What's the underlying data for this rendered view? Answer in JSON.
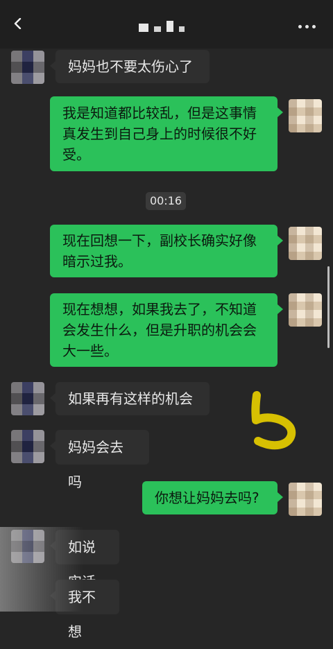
{
  "header": {
    "back_icon": "chevron-left-icon",
    "more_icon": "more-dots-icon"
  },
  "messages": [
    {
      "side": "left",
      "text": "妈妈也不要太伤心了"
    },
    {
      "side": "right",
      "lines": [
        "我是知道都比较乱，但是这事情",
        "真发生到自己身上的时候很不好",
        "受。"
      ]
    },
    {
      "type": "time",
      "text": "00:16"
    },
    {
      "side": "right",
      "lines": [
        "现在回想一下，副校长确实好像",
        "暗示过我。"
      ]
    },
    {
      "side": "right",
      "lines": [
        "现在想想，如果我去了，不知道",
        "会发生什么，但是升职的机会会",
        "大一些。"
      ]
    },
    {
      "side": "left",
      "text": "如果再有这样的机会"
    },
    {
      "side": "left",
      "text": "妈妈会去吗"
    },
    {
      "side": "right",
      "text": "你想让妈妈去吗?"
    },
    {
      "side": "left",
      "text": "如说实话"
    },
    {
      "side": "left",
      "text": "我不想"
    }
  ],
  "colors": {
    "background": "#262626",
    "topbar": "#1f1f1f",
    "bubble_left": "#2f2f2f",
    "bubble_right": "#2bc15a",
    "time_bg": "#3a3a3a",
    "scrollbar": "#bdbdbd",
    "doodle": "#e0c800"
  }
}
